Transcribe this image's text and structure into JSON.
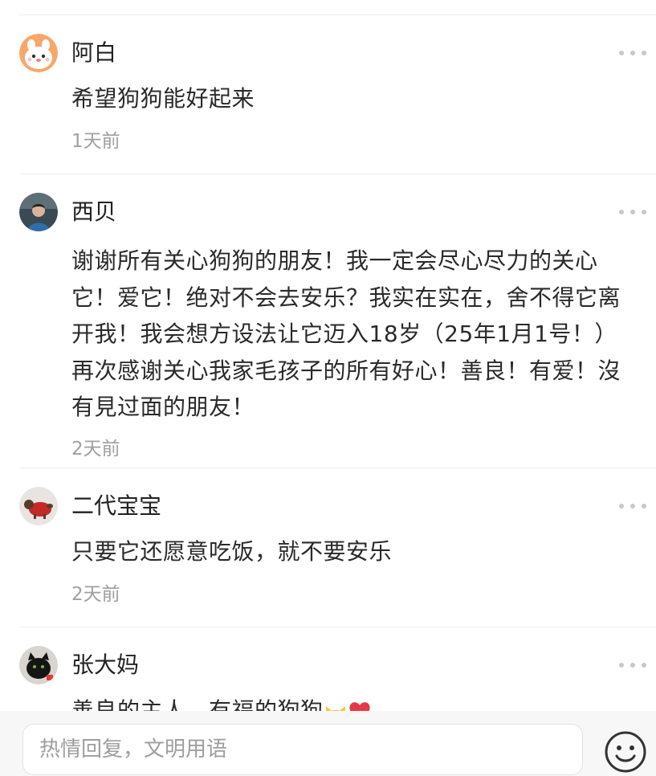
{
  "comments": [
    {
      "username": "阿白",
      "text": "希望狗狗能好起来",
      "time": "1天前",
      "avatar": "cartoon-bunny-avatar"
    },
    {
      "username": "西贝",
      "text": "谢谢所有关心狗狗的朋友！我一定会尽心尽力的关心它！爱它！绝对不会去安乐？我实在实在，舍不得它离开我！我会想方设法让它迈入18岁（25年1月1号！）再次感谢关心我家毛孩子的所有好心！善良！有爱！沒有見过面的朋友！",
      "time": "2天前",
      "avatar": "person-photo-avatar"
    },
    {
      "username": "二代宝宝",
      "text": "只要它还愿意吃饭，就不要安乐",
      "time": "2天前",
      "avatar": "dog-photo-avatar"
    },
    {
      "username": "张大妈",
      "text": "善良的主人，有福的狗狗",
      "time": "",
      "avatar": "black-cat-avatar",
      "emojis": [
        "cat-face-emoji",
        "red-heart-emoji"
      ]
    }
  ],
  "reply": {
    "placeholder": "热情回复，文明用语"
  },
  "colors": {
    "text": "#222222",
    "time": "#a0a0a0",
    "divider": "#ececec",
    "more_dots": "#c8c8c8"
  }
}
